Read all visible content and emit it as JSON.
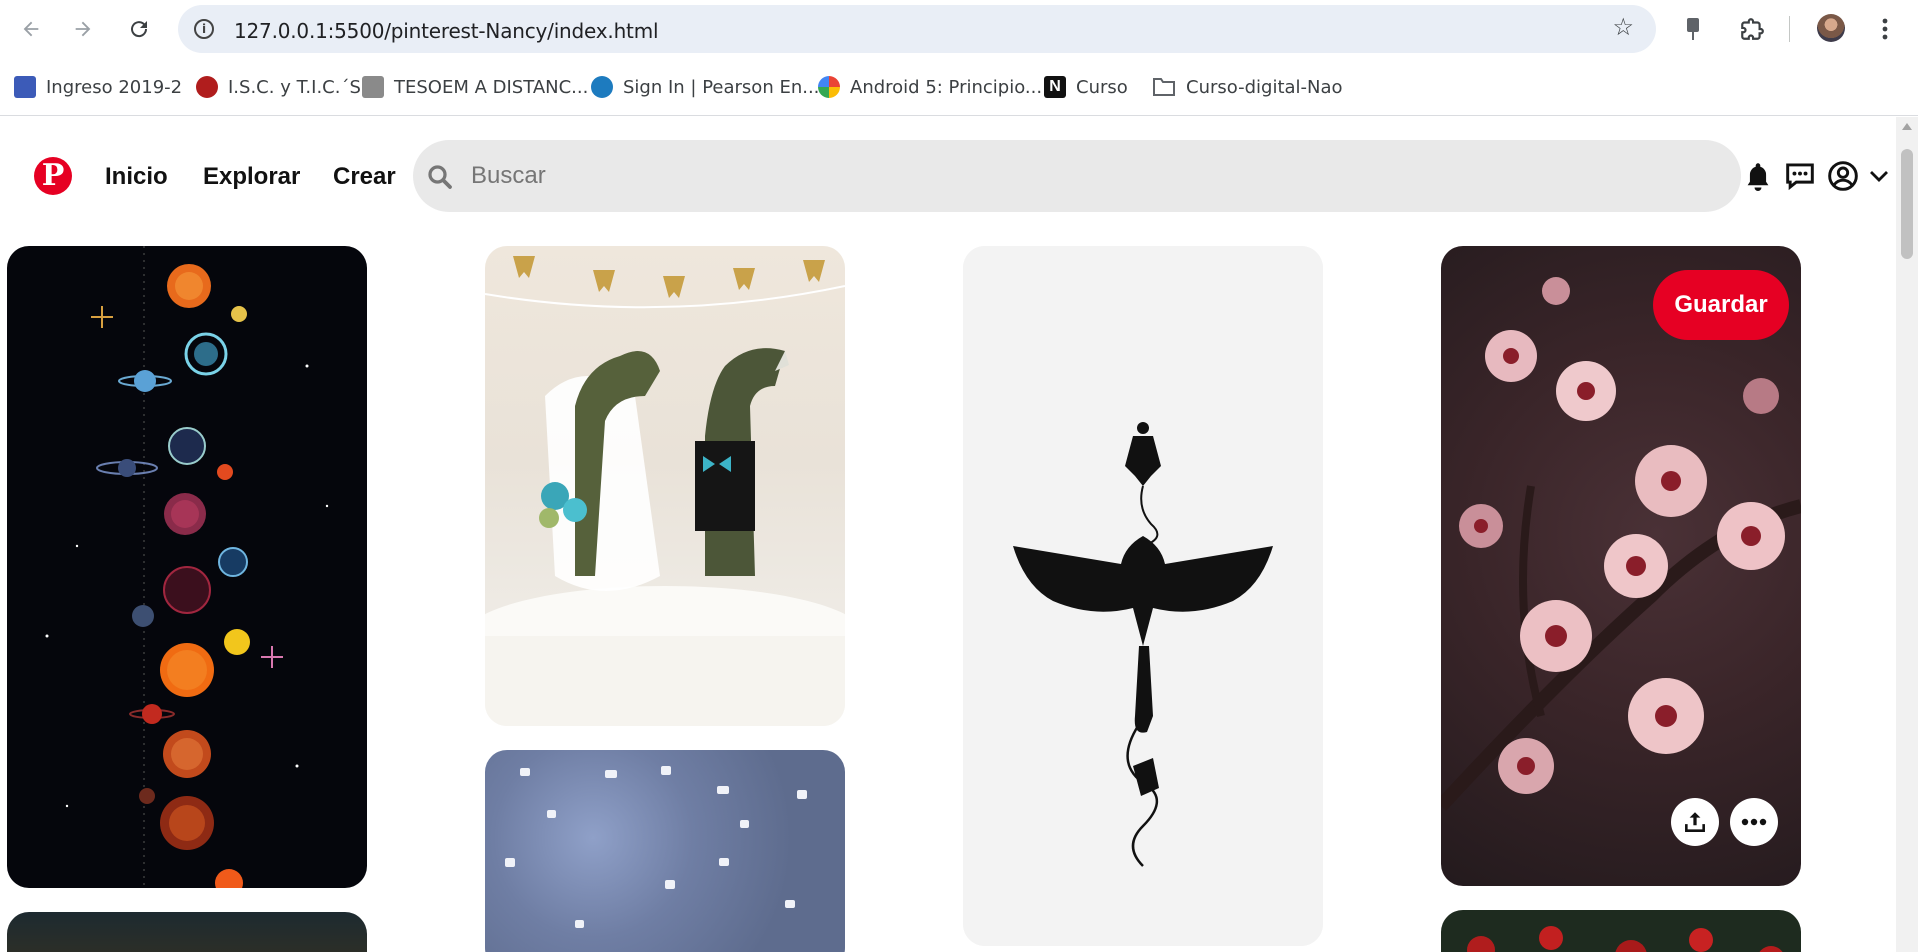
{
  "browser": {
    "url": "127.0.0.1:5500/pinterest-Nancy/index.html",
    "bookmarks": [
      {
        "label": "Ingreso 2019-2",
        "color": "#3c5bb8"
      },
      {
        "label": "I.S.C. y T.I.C.´S",
        "color": "#b01d1d"
      },
      {
        "label": "TESOEM A DISTANC...",
        "color": "#8a8a8a"
      },
      {
        "label": "Sign In | Pearson En...",
        "color": "#1d7bbf"
      },
      {
        "label": "Android 5: Principio...",
        "color": "#4285f4"
      },
      {
        "label": "Curso",
        "color": "#111111"
      },
      {
        "label": "Curso-digital-Nao",
        "color": "#5f6368"
      }
    ]
  },
  "header": {
    "logo": "P",
    "nav": {
      "inicio": "Inicio",
      "explorar": "Explorar",
      "crear": "Crear"
    },
    "search_placeholder": "Buscar"
  },
  "pins": {
    "save_label": "Guardar"
  },
  "colors": {
    "brand": "#e60023",
    "search_bg": "#e9e9e9"
  }
}
